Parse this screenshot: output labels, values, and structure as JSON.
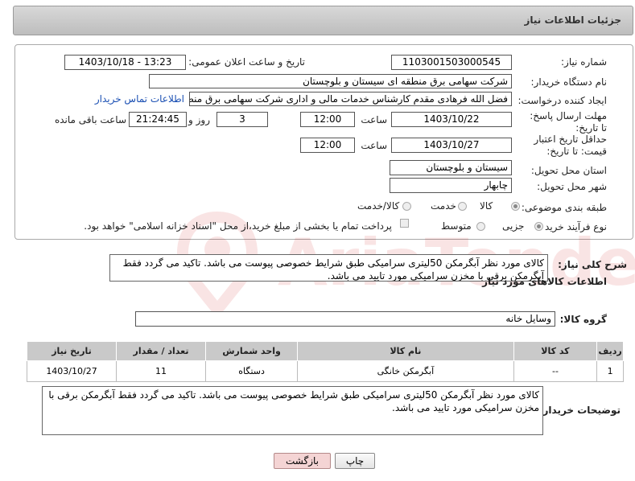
{
  "header": {
    "title": "جزئیات اطلاعات نیاز"
  },
  "fields": {
    "need_number": {
      "label": "شماره نیاز:",
      "value": "1103001503000545"
    },
    "announce_datetime": {
      "label": "تاریخ و ساعت اعلان عمومی:",
      "value": "1403/10/18 - 13:23"
    },
    "buyer_org": {
      "label": "نام دستگاه خریدار:",
      "value": "شرکت سهامی برق منطقه ای سیستان و بلوچستان"
    },
    "creator": {
      "label": "ایجاد کننده درخواست:",
      "value": "فضل الله فرهادی مقدم کارشناس خدمات مالی و اداری شرکت سهامی برق منط",
      "link": "اطلاعات تماس خریدار"
    },
    "deadline": {
      "label": "مهلت ارسال پاسخ: تا تاریخ:",
      "date": "1403/10/22",
      "time_label": "ساعت",
      "time": "12:00",
      "days": "3",
      "days_label": "روز و",
      "remaining": "21:24:45",
      "remaining_label": "ساعت باقی مانده"
    },
    "price_validity": {
      "label": "حداقل تاریخ اعتبار قیمت: تا تاریخ:",
      "date": "1403/10/27",
      "time_label": "ساعت",
      "time": "12:00"
    },
    "province": {
      "label": "استان محل تحویل:",
      "value": "سیستان و بلوچستان"
    },
    "city": {
      "label": "شهر محل تحویل:",
      "value": "چابهار"
    },
    "category": {
      "label": "طبقه بندی موضوعی:",
      "options": [
        "کالا",
        "خدمت",
        "کالا/خدمت"
      ],
      "selected": "کالا"
    },
    "purchase_type": {
      "label": "نوع فرآیند خرید :",
      "options": [
        "جزیی",
        "متوسط"
      ],
      "note": "پرداخت تمام یا بخشی از مبلغ خرید،از محل \"اسناد خزانه اسلامی\" خواهد بود."
    }
  },
  "general_desc": {
    "label": "شرح کلی نیاز:",
    "text": "کالای مورد نظر آبگرمکن 50لیتری سرامیکی طبق شرایط خصوصی پیوست می باشد. تاکید می گردد فقط آبگرمکن برقی با مخزن سرامیکی مورد تایید می باشد."
  },
  "goods_section": {
    "title": "اطلاعات کالاهای مورد نیاز"
  },
  "goods_group": {
    "label": "گروه کالا:",
    "value": "وسایل خانه"
  },
  "table": {
    "headers": [
      "ردیف",
      "کد کالا",
      "نام کالا",
      "واحد شمارش",
      "تعداد / مقدار",
      "تاریخ نیاز"
    ],
    "rows": [
      {
        "row": "1",
        "code": "--",
        "name": "آبگرمکن خانگی",
        "unit": "دستگاه",
        "qty": "11",
        "date": "1403/10/27"
      }
    ]
  },
  "buyer_notes": {
    "label": "توضیحات خریدار:",
    "text": "کالای مورد نظر آبگرمکن 50لیتری سرامیکی طبق شرایط خصوصی پیوست می باشد. تاکید می گردد فقط آبگرمکن برقی با مخزن سرامیکی مورد تایید می باشد."
  },
  "buttons": {
    "print": "چاپ",
    "back": "بازگشت"
  },
  "watermark": "AriaTender.neT",
  "colors": {
    "header_bg": "#c8c8c8",
    "link": "#1a4fb3",
    "back_button": "#f4d4d4",
    "table_header": "#c9c9c9"
  }
}
